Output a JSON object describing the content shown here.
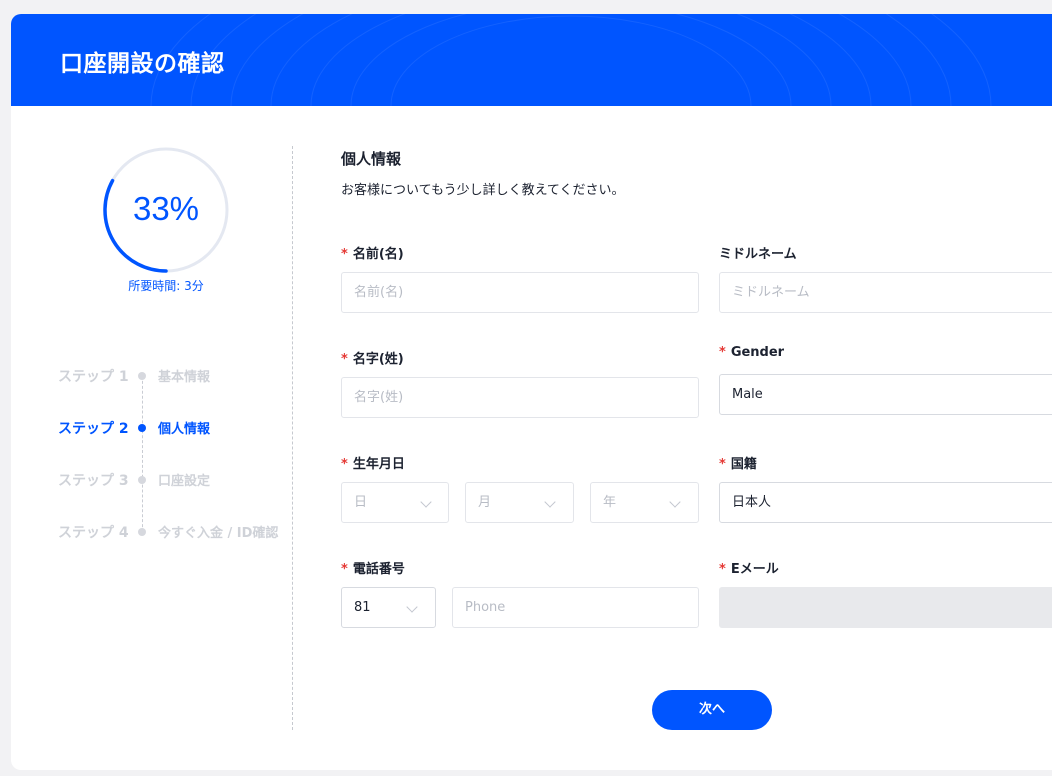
{
  "header": {
    "title": "口座開設の確認"
  },
  "progress": {
    "percent_text": "33%",
    "fraction": 0.33,
    "time_label": "所要時間: 3分"
  },
  "steps": [
    {
      "num": "ステップ 1",
      "name": "基本情報",
      "active": false
    },
    {
      "num": "ステップ 2",
      "name": "個人情報",
      "active": true
    },
    {
      "num": "ステップ 3",
      "name": "口座設定",
      "active": false
    },
    {
      "num": "ステップ 4",
      "name": "今すぐ入金 / ID確認",
      "active": false
    }
  ],
  "form": {
    "section_title": "個人情報",
    "section_sub": "お客様についてもう少し詳しく教えてください。",
    "required_mark": "*",
    "first_name": {
      "label": "名前(名)",
      "placeholder": "名前(名)"
    },
    "middle_name": {
      "label": "ミドルネーム",
      "placeholder": "ミドルネーム"
    },
    "last_name": {
      "label": "名字(姓)",
      "placeholder": "名字(姓)"
    },
    "gender": {
      "label": "Gender",
      "value": "Male"
    },
    "birthdate": {
      "label": "生年月日",
      "day": "日",
      "month": "月",
      "year": "年"
    },
    "nationality": {
      "label": "国籍",
      "value": "日本人"
    },
    "phone": {
      "label": "電話番号",
      "code": "81",
      "placeholder": "Phone"
    },
    "email": {
      "label": "Eメール"
    },
    "next_button": "次へ"
  },
  "colors": {
    "brand": "#0055ff",
    "required": "#e53935"
  }
}
